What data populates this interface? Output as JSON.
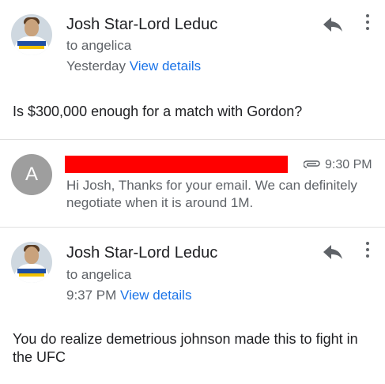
{
  "messages": [
    {
      "sender": "Josh Star-Lord Leduc",
      "recipient": "to angelica",
      "time": "Yesterday",
      "details_link": "View details",
      "body": "Is $300,000 enough for a match with Gordon?"
    },
    {
      "avatar_letter": "A",
      "time": "9:30 PM",
      "snippet": "Hi Josh, Thanks for your email. We can definitely negotiate when it is around 1M."
    },
    {
      "sender": "Josh Star-Lord Leduc",
      "recipient": "to angelica",
      "time": "9:37 PM",
      "details_link": "View details",
      "body": "You do realize demetrious johnson made this to fight in the UFC"
    }
  ],
  "icons": {
    "reply": "reply-icon",
    "more": "more-vert-icon",
    "attachment": "paperclip-icon"
  },
  "colors": {
    "link": "#1a73e8",
    "redaction": "#ff0000",
    "avatar_letter_bg": "#9e9e9e"
  }
}
